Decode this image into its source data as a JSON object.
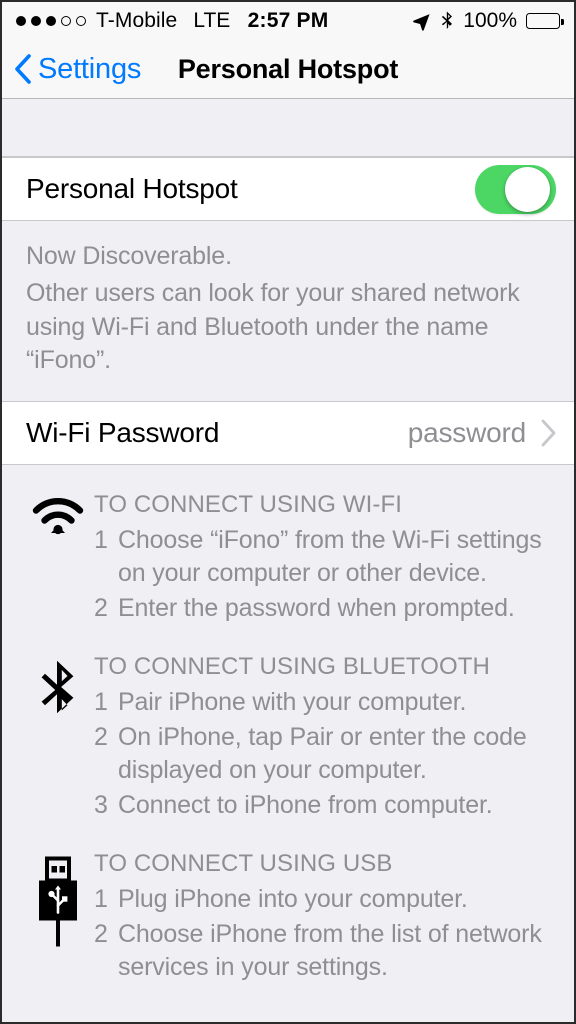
{
  "status_bar": {
    "signal_dots": [
      true,
      true,
      true,
      false,
      false
    ],
    "carrier": "T-Mobile",
    "network_type": "LTE",
    "time": "2:57 PM",
    "location_icon": "location-arrow-icon",
    "bluetooth_icon": "bluetooth-icon",
    "battery_percent": "100%",
    "battery_icon": "battery-full-icon"
  },
  "nav": {
    "back_label": "Settings",
    "back_icon": "chevron-left-icon",
    "title": "Personal Hotspot"
  },
  "hotspot_cell": {
    "label": "Personal Hotspot",
    "toggle_state": "on",
    "toggle_color": "#4cd764"
  },
  "footer": {
    "line1": "Now Discoverable.",
    "line2": "Other users can look for your shared network using Wi-Fi and Bluetooth under the name “iFono”."
  },
  "password_cell": {
    "label": "Wi-Fi Password",
    "value": "password",
    "disclosure_icon": "chevron-right-icon"
  },
  "instructions": [
    {
      "icon": "wifi-icon",
      "heading": "TO CONNECT USING WI-FI",
      "steps": [
        {
          "num": "1",
          "text": "Choose “iFono” from the Wi-Fi settings on your computer or other device."
        },
        {
          "num": "2",
          "text": "Enter the password when prompted."
        }
      ]
    },
    {
      "icon": "bluetooth-icon",
      "heading": "TO CONNECT USING BLUETOOTH",
      "steps": [
        {
          "num": "1",
          "text": "Pair iPhone with your computer."
        },
        {
          "num": "2",
          "text": "On iPhone, tap Pair or enter the code displayed on your computer."
        },
        {
          "num": "3",
          "text": "Connect to iPhone from computer."
        }
      ]
    },
    {
      "icon": "usb-icon",
      "heading": "TO CONNECT USING USB",
      "steps": [
        {
          "num": "1",
          "text": "Plug iPhone into your computer."
        },
        {
          "num": "2",
          "text": "Choose iPhone from the list of network services in your settings."
        }
      ]
    }
  ],
  "colors": {
    "accent_blue": "#007aff",
    "toggle_green": "#4cd764",
    "secondary_text": "#8e8e93",
    "group_background": "#efeff4",
    "bar_background": "#f8f8f8"
  }
}
